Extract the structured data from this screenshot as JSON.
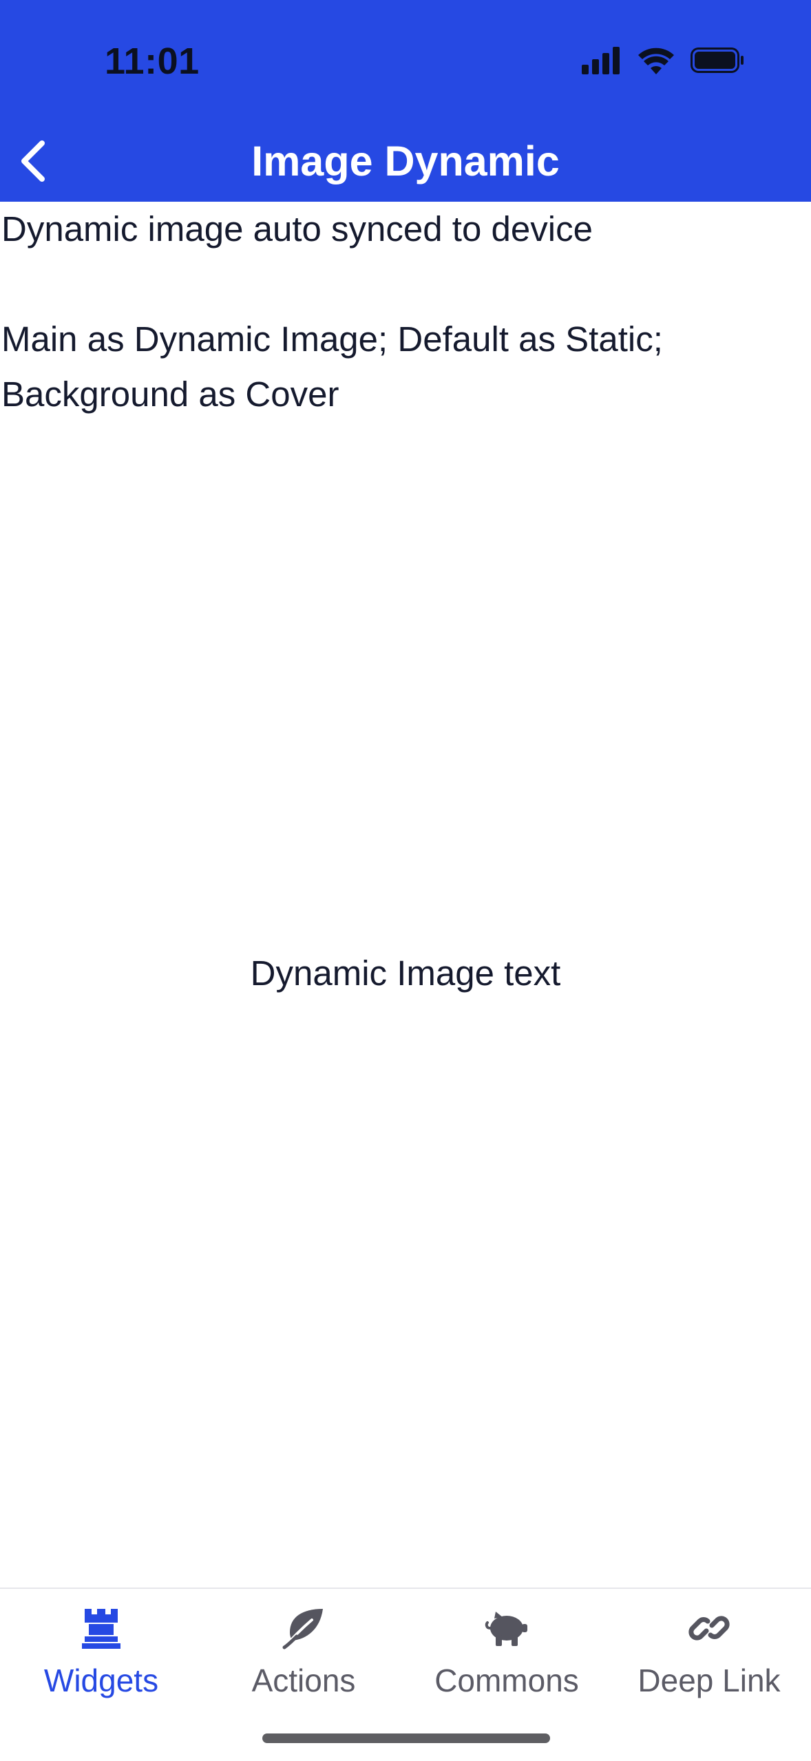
{
  "status_bar": {
    "time": "11:01",
    "icons": [
      "signal-icon",
      "wifi-icon",
      "battery-icon"
    ]
  },
  "nav": {
    "title": "Image Dynamic",
    "back_icon": "chevron-left-icon"
  },
  "content": {
    "description": "Dynamic image auto synced to device\n\nMain as Dynamic Image; Default as Static; Background as Cover",
    "dynamic_image_text": "Dynamic Image text"
  },
  "tabbar": {
    "active_index": 0,
    "tabs": [
      {
        "label": "Widgets",
        "icon": "rook-icon"
      },
      {
        "label": "Actions",
        "icon": "leaf-icon"
      },
      {
        "label": "Commons",
        "icon": "piggy-bank-icon"
      },
      {
        "label": "Deep Link",
        "icon": "link-icon"
      }
    ]
  },
  "colors": {
    "header_bg": "#2649e3",
    "active_tab": "#2649e3",
    "inactive_tab": "#5b5b66",
    "text": "#151a2e"
  }
}
